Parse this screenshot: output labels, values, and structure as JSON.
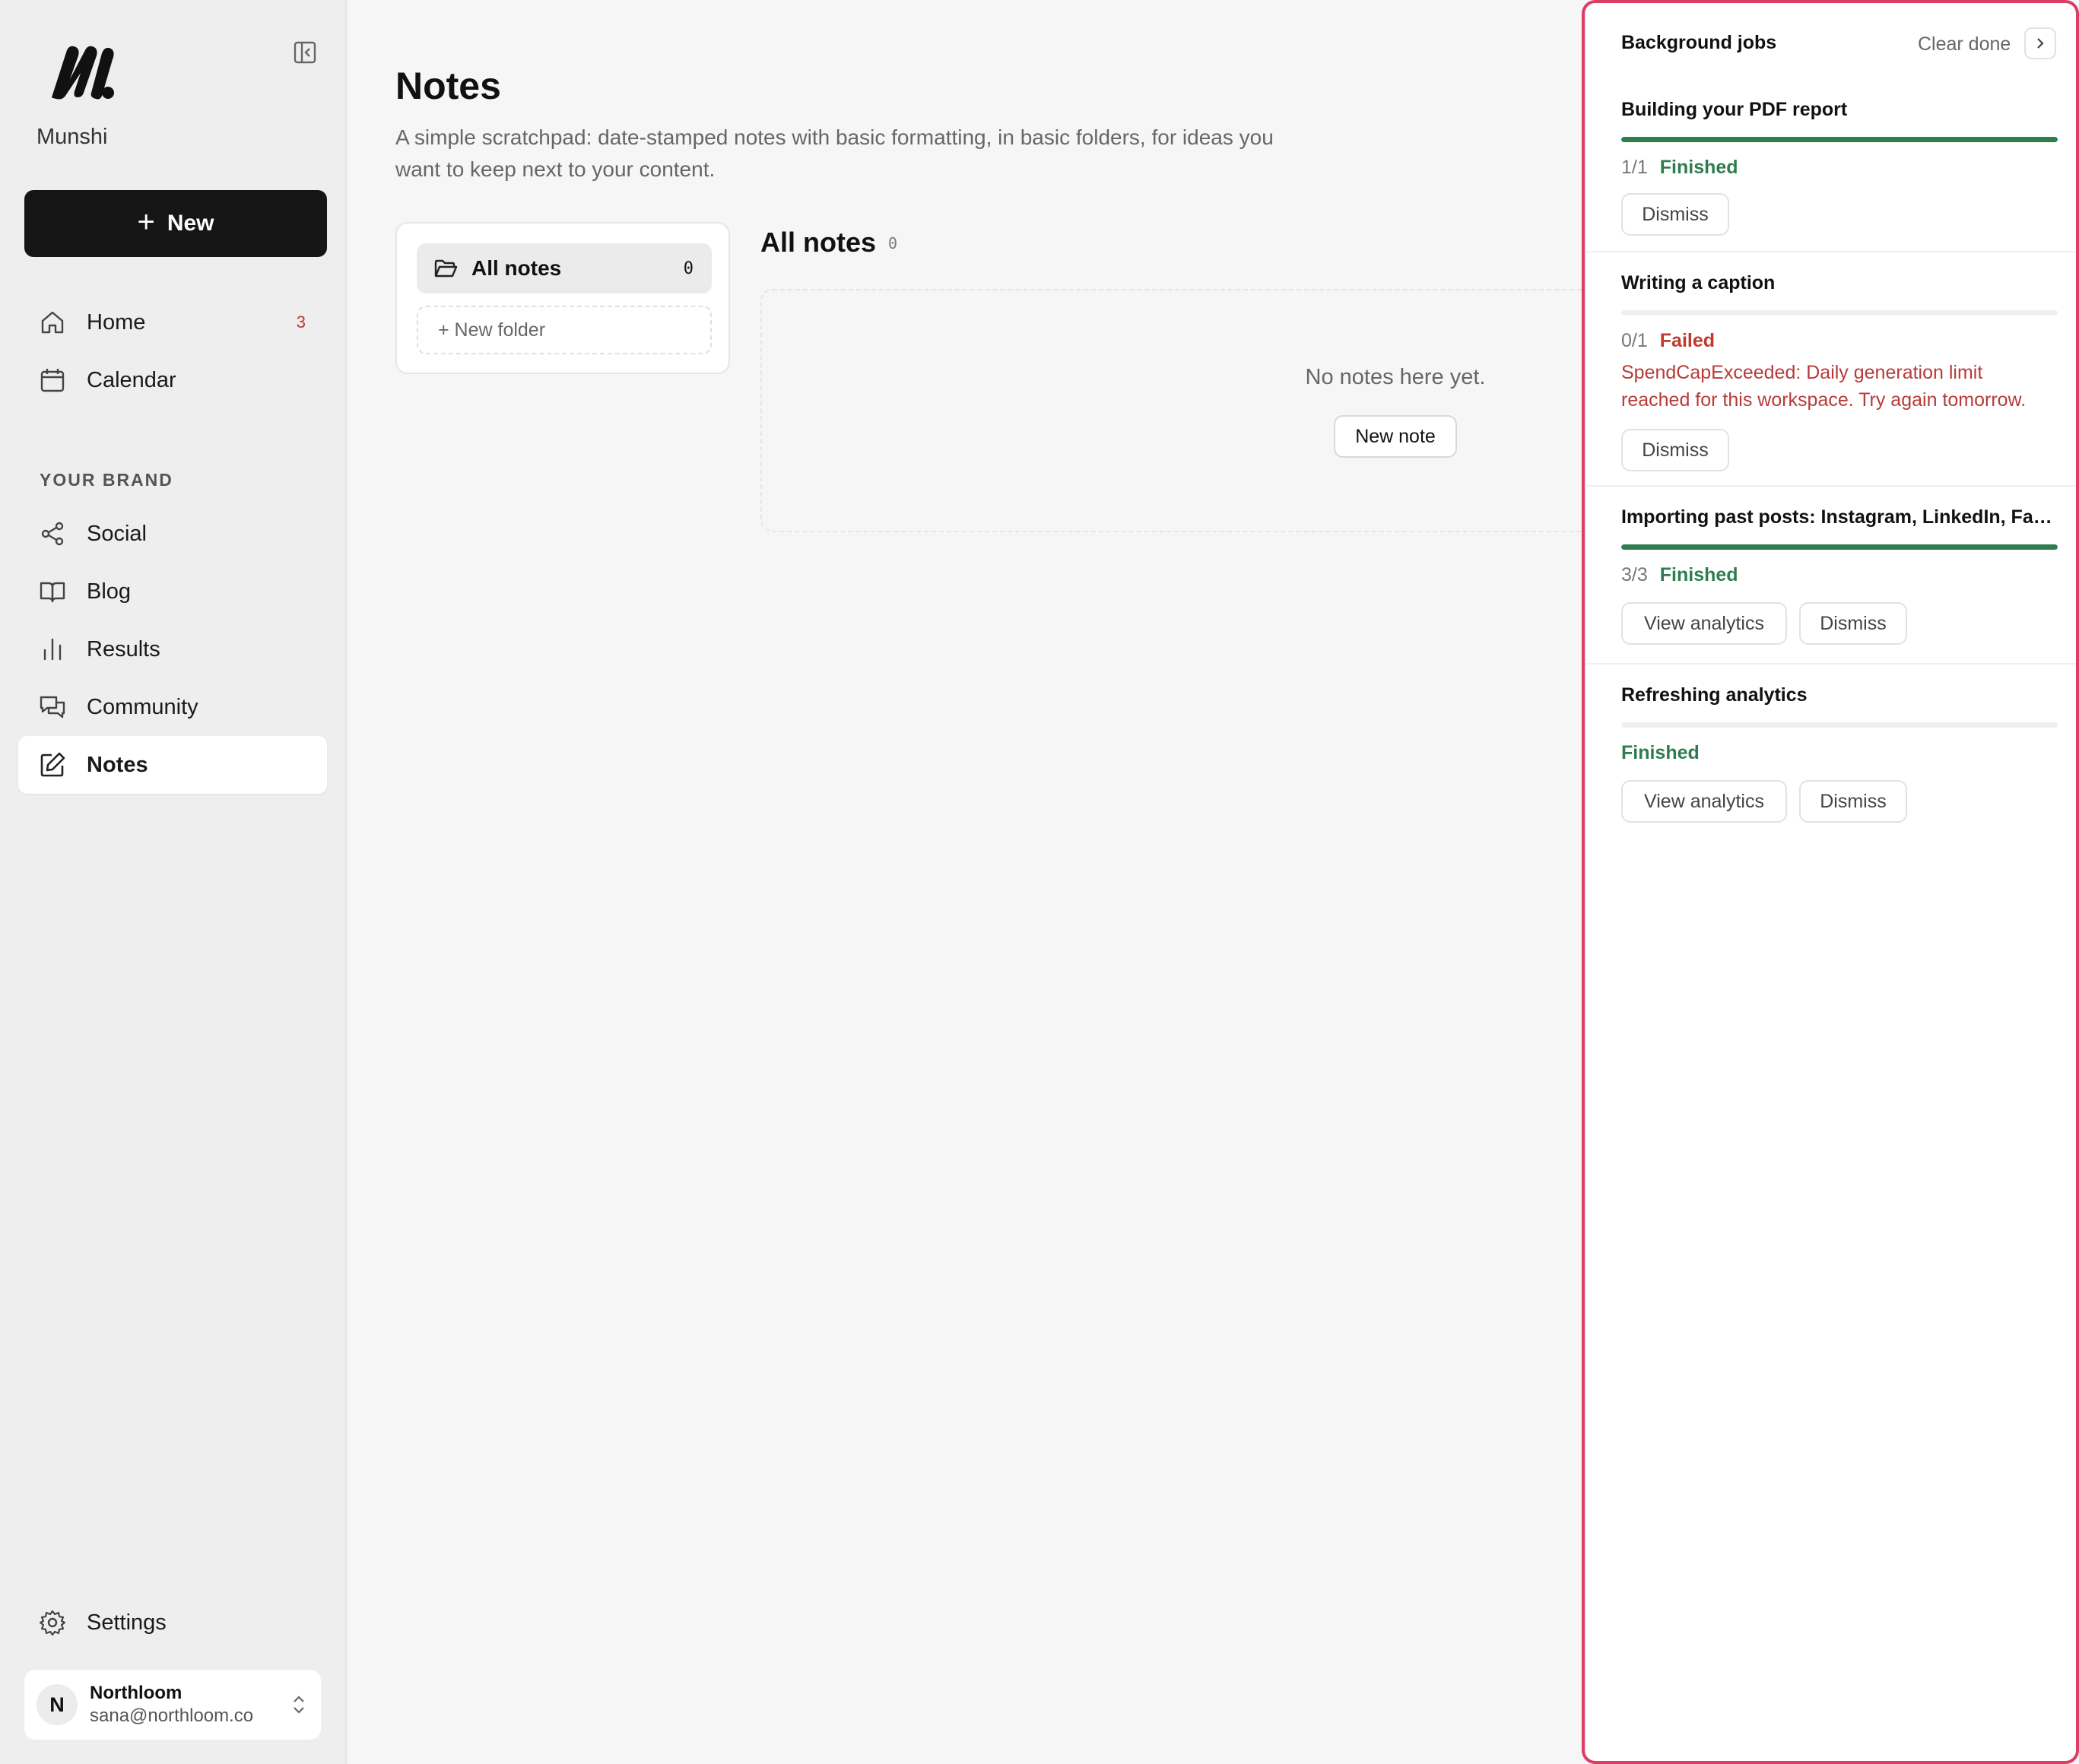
{
  "sidebar": {
    "brand_name": "Munshi",
    "new_button_label": "New",
    "nav": [
      {
        "label": "Home",
        "icon": "home-icon",
        "badge": "3"
      },
      {
        "label": "Calendar",
        "icon": "calendar-icon"
      }
    ],
    "section_label": "YOUR BRAND",
    "brand_nav": [
      {
        "label": "Social",
        "icon": "share-icon"
      },
      {
        "label": "Blog",
        "icon": "book-icon"
      },
      {
        "label": "Results",
        "icon": "bar-chart-icon"
      },
      {
        "label": "Community",
        "icon": "chat-icon"
      },
      {
        "label": "Notes",
        "icon": "edit-icon",
        "active": true
      }
    ],
    "settings_label": "Settings",
    "account": {
      "initial": "N",
      "name": "Northloom",
      "email": "sana@northloom.co"
    }
  },
  "main": {
    "title": "Notes",
    "description": "A simple scratchpad: date-stamped notes with basic formatting, in basic folders, for ideas you want to keep next to your content.",
    "folders": {
      "all_notes_label": "All notes",
      "all_notes_count": "0",
      "new_folder_label": "+ New folder"
    },
    "notes_heading": "All notes",
    "notes_count": "0",
    "empty_text": "No notes here yet.",
    "new_note_label": "New note"
  },
  "jobs_panel": {
    "title": "Background jobs",
    "clear_done_label": "Clear done",
    "jobs": [
      {
        "title": "Building your PDF report",
        "progress_fraction": 1.0,
        "count": "1/1",
        "status": "Finished",
        "buttons": [
          "Dismiss"
        ]
      },
      {
        "title": "Writing a caption",
        "progress_fraction": 0.0,
        "count": "0/1",
        "status": "Failed",
        "error": "SpendCapExceeded: Daily generation limit reached for this workspace. Try again tomorrow.",
        "buttons": [
          "Dismiss"
        ]
      },
      {
        "title": "Importing past posts: Instagram, LinkedIn, Facebook",
        "progress_fraction": 1.0,
        "count": "3/3",
        "status": "Finished",
        "buttons": [
          "View analytics",
          "Dismiss"
        ]
      },
      {
        "title": "Refreshing analytics",
        "progress_fraction": 0.0,
        "count": "",
        "status": "Finished",
        "buttons": [
          "View analytics",
          "Dismiss"
        ]
      }
    ]
  },
  "colors": {
    "accent_success": "#2e7d4f",
    "accent_error": "#c0392b",
    "panel_highlight": "#dc3d63",
    "primary_button": "#151515"
  }
}
